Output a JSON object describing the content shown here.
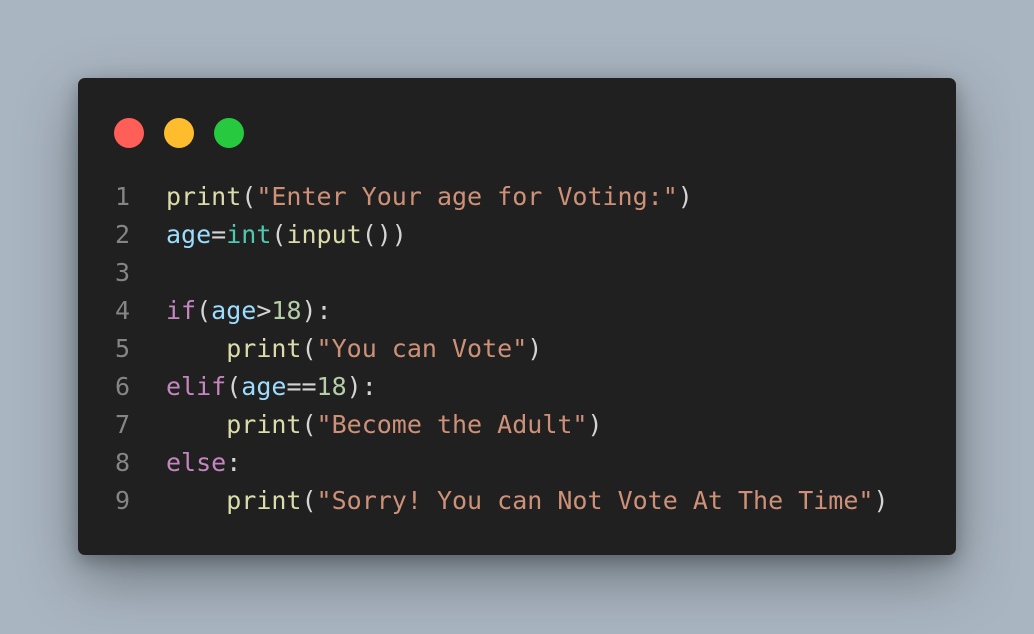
{
  "window": {
    "controls": [
      {
        "name": "close",
        "color": "#ff5f56"
      },
      {
        "name": "minimize",
        "color": "#ffbd2e"
      },
      {
        "name": "maximize",
        "color": "#27c93f"
      }
    ]
  },
  "code": {
    "language": "python",
    "lines": [
      {
        "number": "1",
        "tokens": [
          {
            "t": "print",
            "k": "fn"
          },
          {
            "t": "(",
            "k": "pun"
          },
          {
            "t": "\"Enter Your age for Voting:\"",
            "k": "str"
          },
          {
            "t": ")",
            "k": "pun"
          }
        ]
      },
      {
        "number": "2",
        "tokens": [
          {
            "t": "age",
            "k": "var"
          },
          {
            "t": "=",
            "k": "pun"
          },
          {
            "t": "int",
            "k": "typ"
          },
          {
            "t": "(",
            "k": "pun"
          },
          {
            "t": "input",
            "k": "fn"
          },
          {
            "t": "())",
            "k": "pun"
          }
        ]
      },
      {
        "number": "3",
        "tokens": []
      },
      {
        "number": "4",
        "tokens": [
          {
            "t": "if",
            "k": "kw"
          },
          {
            "t": "(",
            "k": "pun"
          },
          {
            "t": "age",
            "k": "var"
          },
          {
            "t": ">",
            "k": "pun"
          },
          {
            "t": "18",
            "k": "num"
          },
          {
            "t": "):",
            "k": "pun"
          }
        ]
      },
      {
        "number": "5",
        "tokens": [
          {
            "t": "    ",
            "k": "pun"
          },
          {
            "t": "print",
            "k": "fn"
          },
          {
            "t": "(",
            "k": "pun"
          },
          {
            "t": "\"You can Vote\"",
            "k": "str"
          },
          {
            "t": ")",
            "k": "pun"
          }
        ]
      },
      {
        "number": "6",
        "tokens": [
          {
            "t": "elif",
            "k": "kw"
          },
          {
            "t": "(",
            "k": "pun"
          },
          {
            "t": "age",
            "k": "var"
          },
          {
            "t": "==",
            "k": "pun"
          },
          {
            "t": "18",
            "k": "num"
          },
          {
            "t": "):",
            "k": "pun"
          }
        ]
      },
      {
        "number": "7",
        "tokens": [
          {
            "t": "    ",
            "k": "pun"
          },
          {
            "t": "print",
            "k": "fn"
          },
          {
            "t": "(",
            "k": "pun"
          },
          {
            "t": "\"Become the Adult\"",
            "k": "str"
          },
          {
            "t": ")",
            "k": "pun"
          }
        ]
      },
      {
        "number": "8",
        "tokens": [
          {
            "t": "else",
            "k": "kw"
          },
          {
            "t": ":",
            "k": "pun"
          }
        ]
      },
      {
        "number": "9",
        "tokens": [
          {
            "t": "    ",
            "k": "pun"
          },
          {
            "t": "print",
            "k": "fn"
          },
          {
            "t": "(",
            "k": "pun"
          },
          {
            "t": "\"Sorry! You can Not Vote At The Time\"",
            "k": "str"
          },
          {
            "t": ")",
            "k": "pun"
          }
        ]
      }
    ]
  }
}
